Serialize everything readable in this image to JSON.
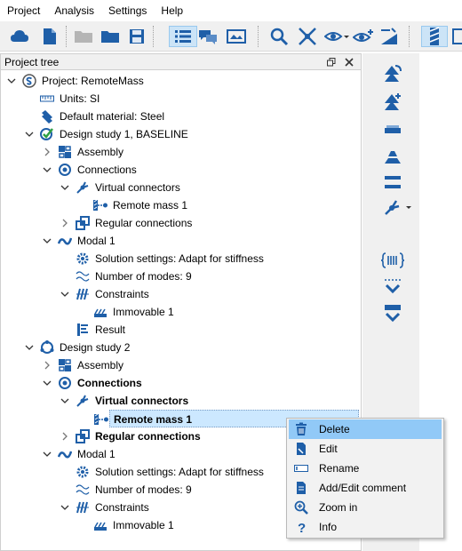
{
  "menu": [
    "Project",
    "Analysis",
    "Settings",
    "Help"
  ],
  "panel": {
    "title": "Project tree"
  },
  "tree": [
    {
      "label": "Project: RemoteMass",
      "icon": "project-icon",
      "chev": "down",
      "indent": 0
    },
    {
      "label": "Units: SI",
      "icon": "ruler-icon",
      "chev": "",
      "indent": 1
    },
    {
      "label": "Default material: Steel",
      "icon": "material-icon",
      "chev": "",
      "indent": 1
    },
    {
      "label": "Design study 1, BASELINE",
      "icon": "design-study-check-icon",
      "chev": "down",
      "indent": 1
    },
    {
      "label": "Assembly",
      "icon": "assembly-icon",
      "chev": "right",
      "indent": 2
    },
    {
      "label": "Connections",
      "icon": "connections-icon",
      "chev": "down",
      "indent": 2
    },
    {
      "label": "Virtual connectors",
      "icon": "virtual-connector-icon",
      "chev": "down",
      "indent": 3
    },
    {
      "label": "Remote mass 1",
      "icon": "remote-mass-icon",
      "chev": "",
      "indent": 4
    },
    {
      "label": "Regular connections",
      "icon": "regular-connections-icon",
      "chev": "right",
      "indent": 3
    },
    {
      "label": "Modal 1",
      "icon": "modal-icon",
      "chev": "down",
      "indent": 2
    },
    {
      "label": "Solution settings: Adapt for stiffness",
      "icon": "gear-icon",
      "chev": "",
      "indent": 3
    },
    {
      "label": "Number of modes: 9",
      "icon": "modes-wave-icon",
      "chev": "",
      "indent": 3
    },
    {
      "label": "Constraints",
      "icon": "constraints-icon",
      "chev": "down",
      "indent": 3
    },
    {
      "label": "Immovable 1",
      "icon": "immovable-icon",
      "chev": "",
      "indent": 4
    },
    {
      "label": "Result",
      "icon": "result-icon",
      "chev": "",
      "indent": 3
    },
    {
      "label": "Design study 2",
      "icon": "design-study-icon",
      "chev": "down",
      "indent": 1
    },
    {
      "label": "Assembly",
      "icon": "assembly-icon",
      "chev": "right",
      "indent": 2
    },
    {
      "label": "Connections",
      "icon": "connections-icon",
      "chev": "down",
      "indent": 2,
      "bold": true
    },
    {
      "label": "Virtual connectors",
      "icon": "virtual-connector-icon",
      "chev": "down",
      "indent": 3,
      "bold": true
    },
    {
      "label": "Remote mass 1",
      "icon": "remote-mass-icon",
      "chev": "",
      "indent": 4,
      "bold": true,
      "selected": true
    },
    {
      "label": "Regular connections",
      "icon": "regular-connections-icon",
      "chev": "right",
      "indent": 3,
      "bold": true
    },
    {
      "label": "Modal 1",
      "icon": "modal-icon",
      "chev": "down",
      "indent": 2
    },
    {
      "label": "Solution settings: Adapt for stiffness",
      "icon": "gear-icon",
      "chev": "",
      "indent": 3
    },
    {
      "label": "Number of modes: 9",
      "icon": "modes-wave-icon",
      "chev": "",
      "indent": 3
    },
    {
      "label": "Constraints",
      "icon": "constraints-icon",
      "chev": "down",
      "indent": 3
    },
    {
      "label": "Immovable 1",
      "icon": "immovable-icon",
      "chev": "",
      "indent": 4
    }
  ],
  "context_menu": [
    {
      "label": "Delete",
      "icon": "trash-icon",
      "highlighted": true
    },
    {
      "label": "Edit",
      "icon": "edit-icon"
    },
    {
      "label": "Rename",
      "icon": "rename-icon"
    },
    {
      "label": "Add/Edit comment",
      "icon": "comment-icon"
    },
    {
      "label": "Zoom in",
      "icon": "zoom-in-icon"
    },
    {
      "label": "Info",
      "icon": "info-icon"
    }
  ],
  "colors": {
    "accent": "#1f5fa8",
    "selection": "#cce8ff",
    "menu_highlight": "#91c9f7",
    "check_green": "#2ea043"
  }
}
